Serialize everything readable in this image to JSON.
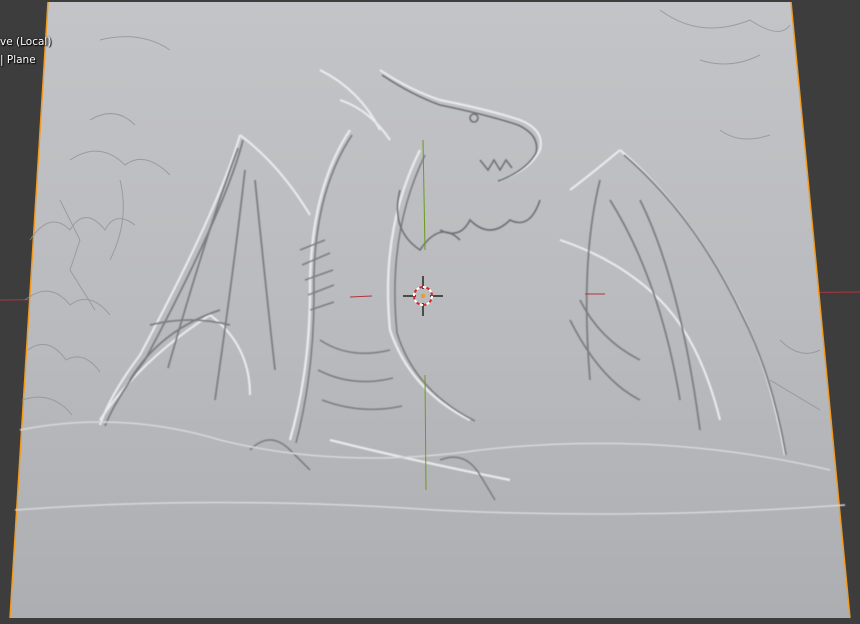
{
  "viewport": {
    "view_mode_text": "ve (Local)",
    "object_text": "| Plane",
    "background_color": "#3d3d3d",
    "plane_color": "#b9babd",
    "selection_outline_color": "#f29b1f",
    "x_axis_color": "#b1343e",
    "y_axis_color": "#6b9b1f",
    "cursor_icon": "3d-cursor-icon",
    "sculpt_subject": "dragon-relief-icon"
  }
}
